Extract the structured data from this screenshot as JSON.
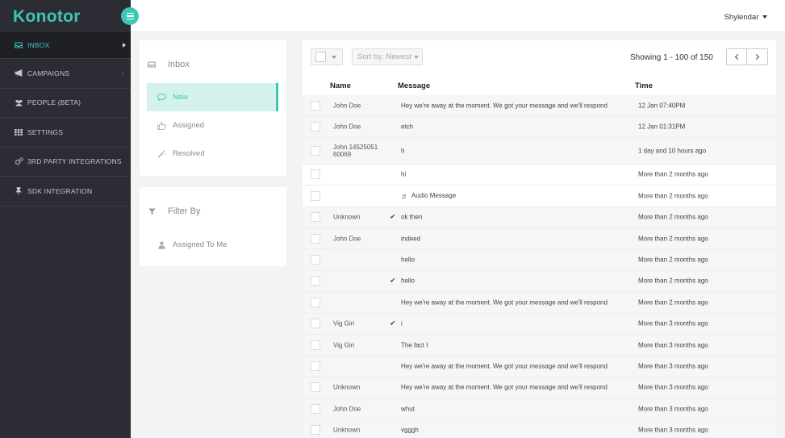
{
  "brand": {
    "name": "Konotor"
  },
  "user": {
    "name": "Shylendar"
  },
  "sidebar": {
    "items": [
      {
        "label": "INBOX",
        "icon": "inbox-icon",
        "active": true
      },
      {
        "label": "CAMPAIGNS",
        "icon": "megaphone-icon"
      },
      {
        "label": "PEOPLE (BETA)",
        "icon": "users-icon"
      },
      {
        "label": "SETTINGS",
        "icon": "grid-icon"
      },
      {
        "label": "3RD PARTY INTEGRATIONS",
        "icon": "cogs-icon"
      },
      {
        "label": "SDK INTEGRATION",
        "icon": "pin-icon"
      }
    ]
  },
  "inbox_panel": {
    "title": "Inbox",
    "filters": [
      {
        "label": "New",
        "icon": "comment-icon",
        "active": true
      },
      {
        "label": "Assigned",
        "icon": "thumbs-up-icon"
      },
      {
        "label": "Resolved",
        "icon": "wand-icon"
      }
    ]
  },
  "filter_panel": {
    "title": "Filter By",
    "items": [
      {
        "label": "Assigned To Me",
        "icon": "user-icon"
      }
    ]
  },
  "toolbar": {
    "sort_label": "Sort by: Newest",
    "showing": "Showing 1 - 100 of 150"
  },
  "table": {
    "columns": {
      "name": "Name",
      "message": "Message",
      "time": "Time"
    },
    "rows": [
      {
        "name": "John Doe",
        "tick": "",
        "message": "Hey we're away at the moment. We got your message and we'll respond",
        "time": "12 Jan 07:40PM"
      },
      {
        "name": "John Doe",
        "tick": "",
        "message": "etch",
        "time": "12 Jan 01:31PM"
      },
      {
        "name": "John.14525051 60069",
        "tick": "",
        "message": "h",
        "time": "1 day and 10 hours ago"
      },
      {
        "name": "",
        "tick": "",
        "message": "hi",
        "time": "More than 2 months ago"
      },
      {
        "name": "",
        "tick": "",
        "message": "Audio Message",
        "time": "More than 2 months ago",
        "audio": true
      },
      {
        "name": "Unknown",
        "tick": "✔",
        "message": "ok then",
        "time": "More than 2 months ago"
      },
      {
        "name": "John Doe",
        "tick": "",
        "message": "indeed",
        "time": "More than 2 months ago"
      },
      {
        "name": "",
        "tick": "",
        "message": "hello",
        "time": "More than 2 months ago"
      },
      {
        "name": "",
        "tick": "✔",
        "message": "hello",
        "time": "More than 2 months ago"
      },
      {
        "name": "",
        "tick": "",
        "message": "Hey we're away at the moment. We got your message and we'll respond",
        "time": "More than 2 months ago"
      },
      {
        "name": "Vig Giri",
        "tick": "✔",
        "message": "i",
        "time": "More than 3 months ago"
      },
      {
        "name": "Vig Giri",
        "tick": "",
        "message": "The fact I",
        "time": "More than 3 months ago"
      },
      {
        "name": "",
        "tick": "",
        "message": "Hey we're away at the moment. We got your message and we'll respond",
        "time": "More than 3 months ago"
      },
      {
        "name": "Unknown",
        "tick": "",
        "message": "Hey we're away at the moment. We got your message and we'll respond",
        "time": "More than 3 months ago"
      },
      {
        "name": "John Doe",
        "tick": "",
        "message": "whut",
        "time": "More than 3 months ago"
      },
      {
        "name": "Unknown",
        "tick": "",
        "message": "vgggh",
        "time": "More than 3 months ago"
      }
    ]
  },
  "colors": {
    "accent": "#3ec6b4",
    "sidebar": "#2b2c34",
    "active_filter_bg": "#d3f2ee"
  }
}
